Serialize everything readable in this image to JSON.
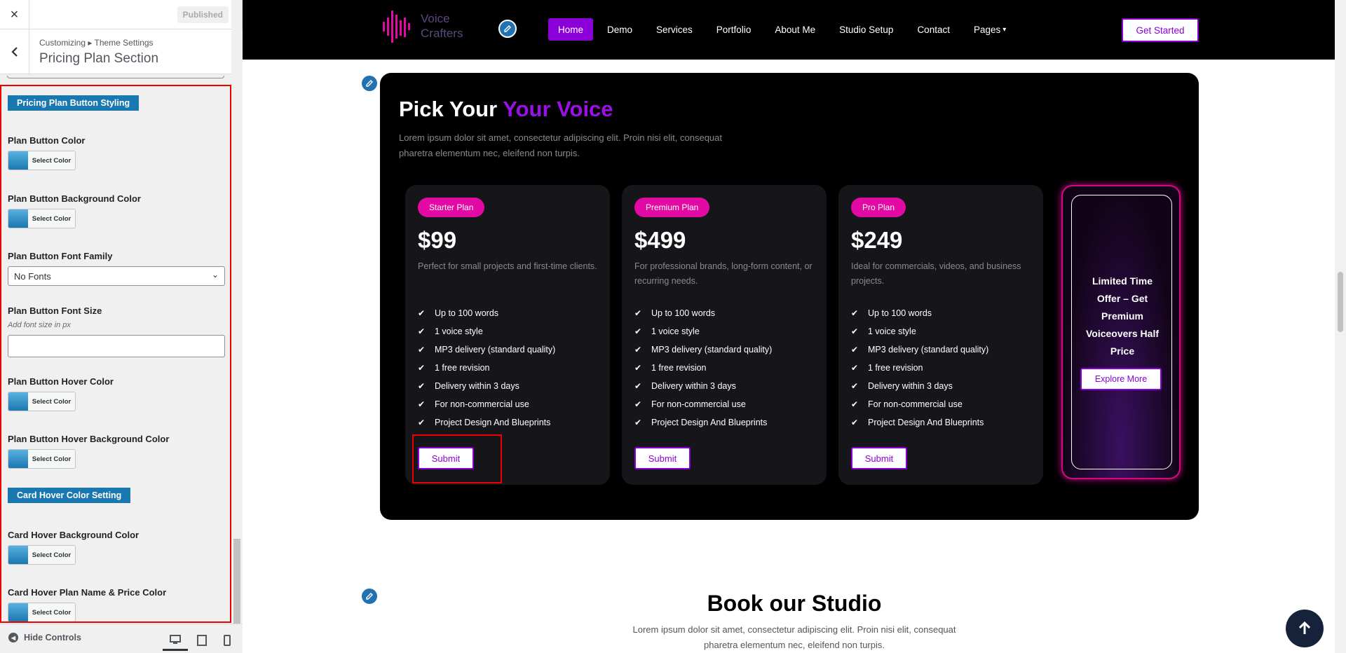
{
  "sidebar": {
    "close_label": "×",
    "published_label": "Published",
    "breadcrumb": "Customizing ▸ Theme Settings",
    "section_title": "Pricing Plan Section",
    "sections": {
      "button_styling": "Pricing Plan Button Styling",
      "card_hover": "Card Hover Color Setting"
    },
    "controls": {
      "plan_button_color": "Plan Button Color",
      "plan_button_bg_color": "Plan Button Background Color",
      "plan_button_font_family": "Plan Button Font Family",
      "font_family_value": "No Fonts",
      "plan_button_font_size": "Plan Button Font Size",
      "font_size_desc": "Add font size in px",
      "font_size_value": "",
      "plan_button_hover_color": "Plan Button Hover Color",
      "plan_button_hover_bg_color": "Plan Button Hover Background Color",
      "card_hover_bg_color": "Card Hover Background Color",
      "card_hover_name_price_color": "Card Hover Plan Name & Price Color"
    },
    "select_color_label": "Select Color",
    "hide_controls_label": "Hide Controls"
  },
  "site": {
    "logo_line1": "Voice",
    "logo_line2": "Crafters",
    "nav": [
      "Home",
      "Demo",
      "Services",
      "Portfolio",
      "About Me",
      "Studio Setup",
      "Contact",
      "Pages"
    ],
    "get_started": "Get Started"
  },
  "pricing": {
    "title_main": "Pick Your ",
    "title_accent": "Your Voice",
    "description": "Lorem ipsum dolor sit amet, consectetur adipiscing elit. Proin nisi elit, consequat pharetra elementum nec, eleifend non turpis.",
    "plans": [
      {
        "badge": "Starter Plan",
        "price": "$99",
        "desc": "Perfect for small projects and first-time clients.",
        "features": [
          "Up to 100 words",
          "1 voice style",
          "MP3 delivery (standard quality)",
          "1 free revision",
          "Delivery within 3 days",
          "For non-commercial use",
          "Project Design And Blueprints"
        ],
        "button": "Submit"
      },
      {
        "badge": "Premium Plan",
        "price": "$499",
        "desc": "For professional brands, long-form content, or recurring needs.",
        "features": [
          "Up to 100 words",
          "1 voice style",
          "MP3 delivery (standard quality)",
          "1 free revision",
          "Delivery within 3 days",
          "For non-commercial use",
          "Project Design And Blueprints"
        ],
        "button": "Submit"
      },
      {
        "badge": "Pro Plan",
        "price": "$249",
        "desc": "Ideal for commercials, videos, and business projects.",
        "features": [
          "Up to 100 words",
          "1 voice style",
          "MP3 delivery (standard quality)",
          "1 free revision",
          "Delivery within 3 days",
          "For non-commercial use",
          "Project Design And Blueprints"
        ],
        "button": "Submit"
      }
    ],
    "promo": {
      "text": "Limited Time Offer – Get Premium Voiceovers Half Price",
      "button": "Explore More"
    }
  },
  "studio": {
    "title": "Book our Studio",
    "description": "Lorem ipsum dolor sit amet, consectetur adipiscing elit. Proin nisi elit, consequat pharetra elementum nec, eleifend non turpis."
  },
  "colors": {
    "accent_purple": "#8b00d9",
    "badge_pink": "#e20aa3",
    "wp_blue": "#2271b1",
    "highlight_red": "#ee0000"
  }
}
